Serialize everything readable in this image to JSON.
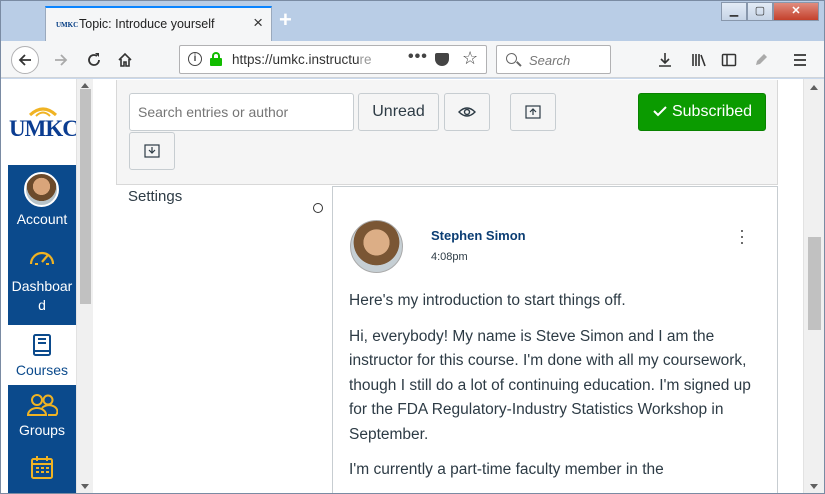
{
  "browser": {
    "tab_title": "Topic: Introduce yourself",
    "tab_favicon_text": "UMKC",
    "new_tab_symbol": "+",
    "url_host": "https://umkc.instructu",
    "url_fade": "re",
    "search_placeholder": "Search",
    "window_buttons": {
      "minimize": "▁",
      "maximize": "▢",
      "close": "✕"
    }
  },
  "global_nav": {
    "logo_text": "UMKC",
    "items": [
      {
        "label": "Account",
        "icon": "avatar"
      },
      {
        "label": "Dashboard",
        "icon": "gauge-icon"
      },
      {
        "label": "Courses",
        "icon": "book-icon"
      },
      {
        "label": "Groups",
        "icon": "people-icon"
      },
      {
        "label": "Calendar",
        "icon": "calendar-icon"
      }
    ],
    "dashboard_line1": "Dashboar",
    "dashboard_line2": "d"
  },
  "discussion_toolbar": {
    "search_placeholder": "Search entries or author",
    "unread_label": "Unread",
    "subscribed_label": "Subscribed"
  },
  "sidebar": {
    "settings_label": "Settings"
  },
  "entry": {
    "author": "Stephen Simon",
    "time": "4:08pm",
    "paragraphs": [
      "Here's my introduction to start things off.",
      "Hi, everybody! My name is Steve Simon and I am the instructor for this course. I'm done with all my coursework, though I still do a lot of continuing education. I'm signed up for the FDA Regulatory-Industry Statistics Workshop in September.",
      "I'm currently a part-time faculty member in the"
    ]
  },
  "colors": {
    "nav_blue": "#0b4a8c",
    "subscribed_green": "#0b9b00",
    "author_link": "#0b3d73",
    "logo_gold": "#f0b323"
  }
}
